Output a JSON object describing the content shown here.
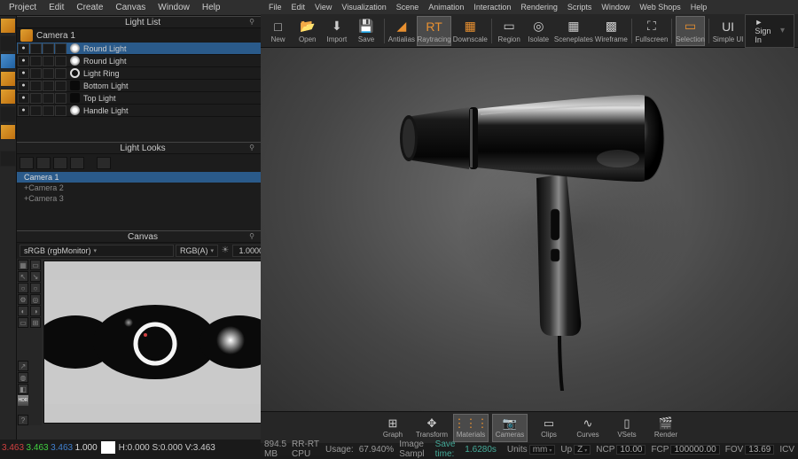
{
  "left": {
    "menubar": [
      "Project",
      "Edit",
      "Create",
      "Canvas",
      "Window",
      "Help"
    ],
    "camera_label": "Camera 1",
    "panels": {
      "light_list": "Light List",
      "light_looks": "Light Looks",
      "canvas": "Canvas"
    },
    "lights": [
      {
        "name": "Round Light",
        "selected": true,
        "icon": "round"
      },
      {
        "name": "Round Light",
        "selected": false,
        "icon": "round"
      },
      {
        "name": "Light Ring",
        "selected": false,
        "icon": "ring"
      },
      {
        "name": "Bottom Light",
        "selected": false,
        "icon": "dark"
      },
      {
        "name": "Top Light",
        "selected": false,
        "icon": "dark"
      },
      {
        "name": "Handle Light",
        "selected": false,
        "icon": "round"
      }
    ],
    "looks": [
      {
        "name": "Camera 1",
        "selected": true
      },
      {
        "name": "+Camera 2",
        "selected": false
      },
      {
        "name": "+Camera 3",
        "selected": false
      }
    ],
    "canvas": {
      "monitor": "sRGB (rgbMonitor)",
      "format": "RGB(A)",
      "exposure": "1.0000"
    },
    "status": {
      "a1": "3.463",
      "a2": "3.463",
      "a3": "3.463",
      "a4": "1.000",
      "rest": "H:0.000 S:0.000 V:3.463"
    }
  },
  "right": {
    "menubar": [
      "File",
      "Edit",
      "View",
      "Visualization",
      "Scene",
      "Animation",
      "Interaction",
      "Rendering",
      "Scripts",
      "Window",
      "Web Shops",
      "Help"
    ],
    "toolbar": [
      {
        "label": "New",
        "icon": "□"
      },
      {
        "label": "Open",
        "icon": "📂"
      },
      {
        "label": "Import",
        "icon": "⬇"
      },
      {
        "label": "Save",
        "icon": "💾"
      },
      {
        "sep": true
      },
      {
        "label": "Antialias",
        "icon": "◢",
        "orange": true
      },
      {
        "label": "Raytracing",
        "icon": "RT",
        "orange": true,
        "active": true
      },
      {
        "label": "Downscale",
        "icon": "▦",
        "orange": true
      },
      {
        "sep": true
      },
      {
        "label": "Region",
        "icon": "▭"
      },
      {
        "label": "Isolate",
        "icon": "◎"
      },
      {
        "label": "Sceneplates",
        "icon": "▦"
      },
      {
        "label": "Wireframe",
        "icon": "▩"
      },
      {
        "sep": true
      },
      {
        "label": "Fullscreen",
        "icon": "⛶"
      },
      {
        "sep": true
      },
      {
        "label": "Selection",
        "icon": "▭",
        "orange": true,
        "active": true
      },
      {
        "sep": true
      },
      {
        "label": "Simple UI",
        "icon": "UI"
      }
    ],
    "signin": "Sign In",
    "bottom_toolbar": [
      {
        "label": "Graph",
        "icon": "⊞"
      },
      {
        "label": "Transform",
        "icon": "✥"
      },
      {
        "label": "Materials",
        "icon": "⋮⋮⋮",
        "orange": true,
        "active": true
      },
      {
        "label": "Cameras",
        "icon": "📷",
        "orange": true,
        "active": true
      },
      {
        "label": "Clips",
        "icon": "▭"
      },
      {
        "label": "Curves",
        "icon": "∿"
      },
      {
        "label": "VSets",
        "icon": "▯"
      },
      {
        "label": "Render",
        "icon": "🎬"
      }
    ],
    "status": {
      "mem": "894.5 MB",
      "engine": "RR-RT CPU",
      "usage_label": "Usage:",
      "usage": "67.940%",
      "mode": "Image Sampl",
      "save_label": "Save time:",
      "save_time": "1.6280s",
      "units_label": "Units",
      "units": "mm",
      "up_label": "Up",
      "up": "Z",
      "ncp_label": "NCP",
      "ncp": "10.00",
      "fcp_label": "FCP",
      "fcp": "100000.00",
      "fov_label": "FOV",
      "fov": "13.69",
      "icv_label": "ICV"
    }
  }
}
